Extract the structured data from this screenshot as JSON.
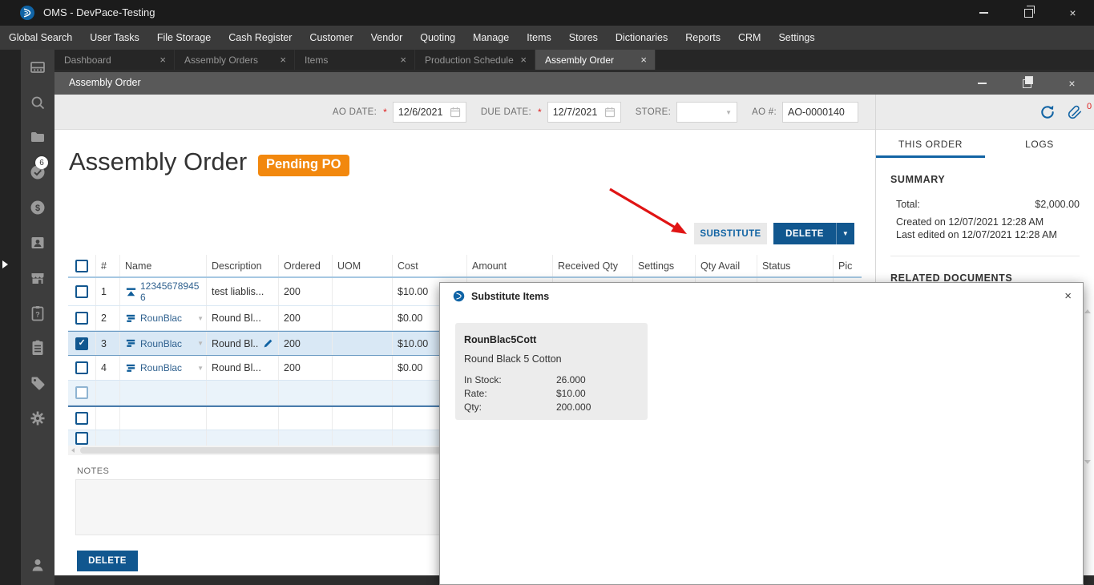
{
  "glyphs": {
    "close": "×"
  },
  "colors": {
    "accent_blue": "#1264a4",
    "button_blue": "#11578f",
    "badge_orange": "#f2880e",
    "alert_red": "#e02020",
    "selected_row": "#d9e8f5",
    "sidebar_dark": "#3d3d3d",
    "titlebar_dark": "#1b1b1b"
  },
  "titlebar": {
    "title": "OMS - DevPace-Testing"
  },
  "menubar": {
    "items": [
      {
        "label": "Global Search"
      },
      {
        "label": "User Tasks"
      },
      {
        "label": "File Storage"
      },
      {
        "label": "Cash Register"
      },
      {
        "label": "Customer"
      },
      {
        "label": "Vendor"
      },
      {
        "label": "Quoting"
      },
      {
        "label": "Manage"
      },
      {
        "label": "Items"
      },
      {
        "label": "Stores"
      },
      {
        "label": "Dictionaries"
      },
      {
        "label": "Reports"
      },
      {
        "label": "CRM"
      },
      {
        "label": "Settings"
      }
    ]
  },
  "tabbar": {
    "tabs": [
      {
        "label": "Dashboard"
      },
      {
        "label": "Assembly Orders"
      },
      {
        "label": "Items"
      },
      {
        "label": "Production Schedule"
      },
      {
        "label": "Assembly Order",
        "active": true
      }
    ]
  },
  "sidebar": {
    "icons": [
      "cash-register",
      "search",
      "file-storage",
      "tasks-check",
      "payments-dollar",
      "customer-card",
      "storefront",
      "clipboard-question",
      "clipboard-list",
      "tag",
      "settings-gear",
      "account-person"
    ],
    "task_badge": "6"
  },
  "window": {
    "title": "Assembly Order",
    "toolbar": {
      "ao_date_label": "AO DATE:",
      "ao_date": "12/6/2021",
      "due_date_label": "DUE DATE:",
      "due_date": "12/7/2021",
      "store_label": "STORE:",
      "store_value": "",
      "ao_no_label": "AO #:",
      "ao_no": "AO-0000140",
      "attachment_count": "0"
    },
    "page_title": "Assembly Order",
    "status_badge": "Pending PO",
    "buttons": {
      "substitute": "SUBSTITUTE",
      "delete": "DELETE"
    },
    "table": {
      "headers": [
        {
          "label": "#"
        },
        {
          "label": "Name"
        },
        {
          "label": "Description"
        },
        {
          "label": "Ordered"
        },
        {
          "label": "UOM"
        },
        {
          "label": "Cost"
        },
        {
          "label": "Amount"
        },
        {
          "label": "Received Qty"
        },
        {
          "label": "Settings"
        },
        {
          "label": "Qty Avail"
        },
        {
          "label": "Status"
        },
        {
          "label": "Pic"
        }
      ],
      "rows": [
        {
          "num": "1",
          "name": "123456789456",
          "desc": "test liablis...",
          "ordered": "200",
          "uom": "",
          "cost": "$10.00",
          "amount": "",
          "received_qty": "",
          "settings": "",
          "qty_avail": "",
          "status": "",
          "pic": "",
          "is_assembly": true
        },
        {
          "num": "2",
          "name": "RounBlac",
          "desc": "Round Bl...",
          "ordered": "200",
          "uom": "",
          "cost": "$0.00",
          "amount": "",
          "received_qty": "",
          "settings": "",
          "qty_avail": "",
          "status": "",
          "pic": "",
          "is_bom": true,
          "has_dropdown": true
        },
        {
          "num": "3",
          "name": "RounBlac",
          "desc": "Round Bl...",
          "ordered": "200",
          "uom": "",
          "cost": "$10.00",
          "amount": "",
          "received_qty": "",
          "settings": "",
          "qty_avail": "",
          "status": "",
          "pic": "",
          "is_bom": true,
          "has_dropdown": true,
          "has_edit": true,
          "checked": true,
          "selected": true
        },
        {
          "num": "4",
          "name": "RounBlac",
          "desc": "Round Bl...",
          "ordered": "200",
          "uom": "",
          "cost": "$0.00",
          "amount": "",
          "received_qty": "",
          "settings": "",
          "qty_avail": "",
          "status": "",
          "pic": "",
          "is_bom": true,
          "has_dropdown": true
        },
        {
          "empty": true,
          "alt": true,
          "light_check": true,
          "num": "",
          "name": "",
          "desc": "",
          "ordered": "",
          "uom": "",
          "cost": "",
          "amount": "",
          "received_qty": "",
          "settings": "",
          "qty_avail": "",
          "status": "",
          "pic": ""
        },
        {
          "empty": true,
          "divider": true,
          "num": "",
          "name": "",
          "desc": "",
          "ordered": "",
          "uom": "",
          "cost": "",
          "amount": "",
          "received_qty": "",
          "settings": "",
          "qty_avail": "",
          "status": "",
          "pic": ""
        },
        {
          "empty": true,
          "alt": true,
          "cut": true,
          "num": "",
          "name": "",
          "desc": "",
          "ordered": "",
          "uom": "",
          "cost": "",
          "amount": "",
          "received_qty": "",
          "settings": "",
          "qty_avail": "",
          "status": "",
          "pic": ""
        }
      ]
    },
    "notes_label": "NOTES",
    "bottom_delete": "DELETE"
  },
  "right_panel": {
    "tabs": [
      {
        "label": "THIS ORDER",
        "active": true
      },
      {
        "label": "LOGS"
      }
    ],
    "summary_title": "SUMMARY",
    "total_label": "Total:",
    "total_value": "$2,000.00",
    "created": "Created on 12/07/2021 12:28 AM",
    "last_edited": "Last edited on 12/07/2021 12:28 AM",
    "related_title": "RELATED DOCUMENTS"
  },
  "dialog": {
    "title": "Substitute Items",
    "card": {
      "name": "RounBlac5Cott",
      "description": "Round Black 5 Cotton",
      "fields": [
        {
          "label": "In Stock:",
          "value": "26.000"
        },
        {
          "label": "Rate:",
          "value": "$10.00"
        },
        {
          "label": "Qty:",
          "value": "200.000"
        }
      ]
    }
  }
}
